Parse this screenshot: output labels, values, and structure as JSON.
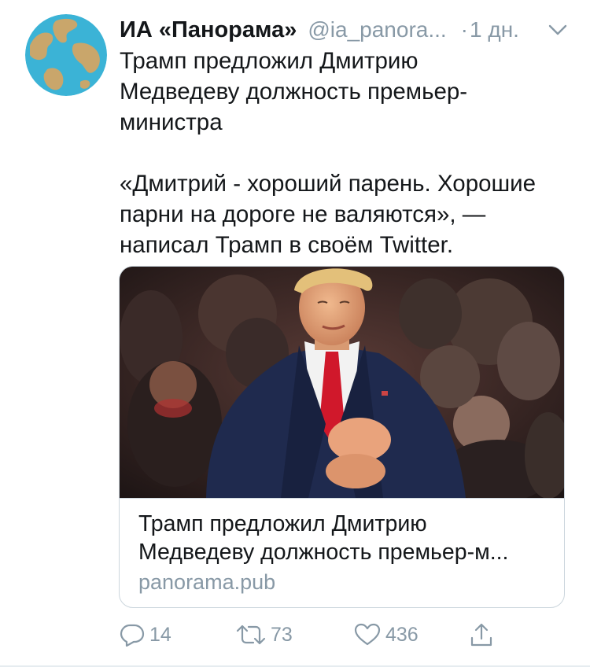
{
  "author": {
    "name": "ИА «Панорама»",
    "handle": "@ia_panora...",
    "time_separator": "·",
    "time": "1 дн."
  },
  "tweet": {
    "paragraph1": "Трамп предложил Дмитрию\nМедведеву должность премьер-\nминистра",
    "paragraph2": "«Дмитрий - хороший парень. Хорошие\nпарни на дороге не валяются», —\nнаписал Трамп в своём Twitter."
  },
  "card": {
    "title_line1": "Трамп предложил Дмитрию",
    "title_line2": "Медведеву должность премьер-м...",
    "domain": "panorama.pub"
  },
  "actions": {
    "replies": "14",
    "retweets": "73",
    "likes": "436"
  },
  "icons": {
    "avatar": "globe-icon",
    "caret": "chevron-down-icon",
    "reply": "reply-icon",
    "retweet": "retweet-icon",
    "like": "heart-icon",
    "share": "share-icon"
  },
  "colors": {
    "text": "#14171a",
    "secondary": "#8899a6",
    "border": "#ccd6dd",
    "ocean": "#3bb3d6",
    "land": "#c9a66b"
  }
}
